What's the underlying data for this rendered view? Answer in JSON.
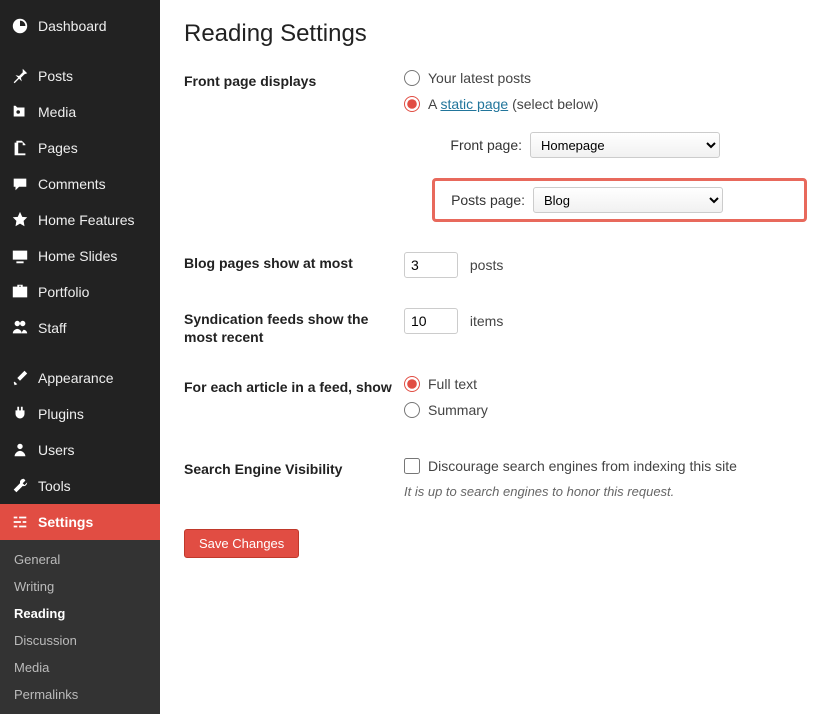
{
  "sidebar": {
    "items": [
      {
        "label": "Dashboard"
      },
      {
        "label": "Posts"
      },
      {
        "label": "Media"
      },
      {
        "label": "Pages"
      },
      {
        "label": "Comments"
      },
      {
        "label": "Home Features"
      },
      {
        "label": "Home Slides"
      },
      {
        "label": "Portfolio"
      },
      {
        "label": "Staff"
      },
      {
        "label": "Appearance"
      },
      {
        "label": "Plugins"
      },
      {
        "label": "Users"
      },
      {
        "label": "Tools"
      },
      {
        "label": "Settings"
      }
    ],
    "sub_items": [
      {
        "label": "General"
      },
      {
        "label": "Writing"
      },
      {
        "label": "Reading"
      },
      {
        "label": "Discussion"
      },
      {
        "label": "Media"
      },
      {
        "label": "Permalinks"
      }
    ]
  },
  "page": {
    "title": "Reading Settings",
    "front_page_label": "Front page displays",
    "radio_latest": "Your latest posts",
    "radio_static_prefix": "A ",
    "radio_static_link": "static page",
    "radio_static_suffix": " (select below)",
    "front_page_select_label": "Front page:",
    "front_page_value": "Homepage",
    "posts_page_select_label": "Posts page:",
    "posts_page_value": "Blog",
    "blog_pages_label": "Blog pages show at most",
    "blog_pages_value": "3",
    "blog_pages_unit": "posts",
    "syndication_label": "Syndication feeds show the most recent",
    "syndication_value": "10",
    "syndication_unit": "items",
    "feed_article_label": "For each article in a feed, show",
    "feed_full": "Full text",
    "feed_summary": "Summary",
    "search_visibility_label": "Search Engine Visibility",
    "search_visibility_check": "Discourage search engines from indexing this site",
    "search_visibility_desc": "It is up to search engines to honor this request.",
    "save_button": "Save Changes"
  }
}
